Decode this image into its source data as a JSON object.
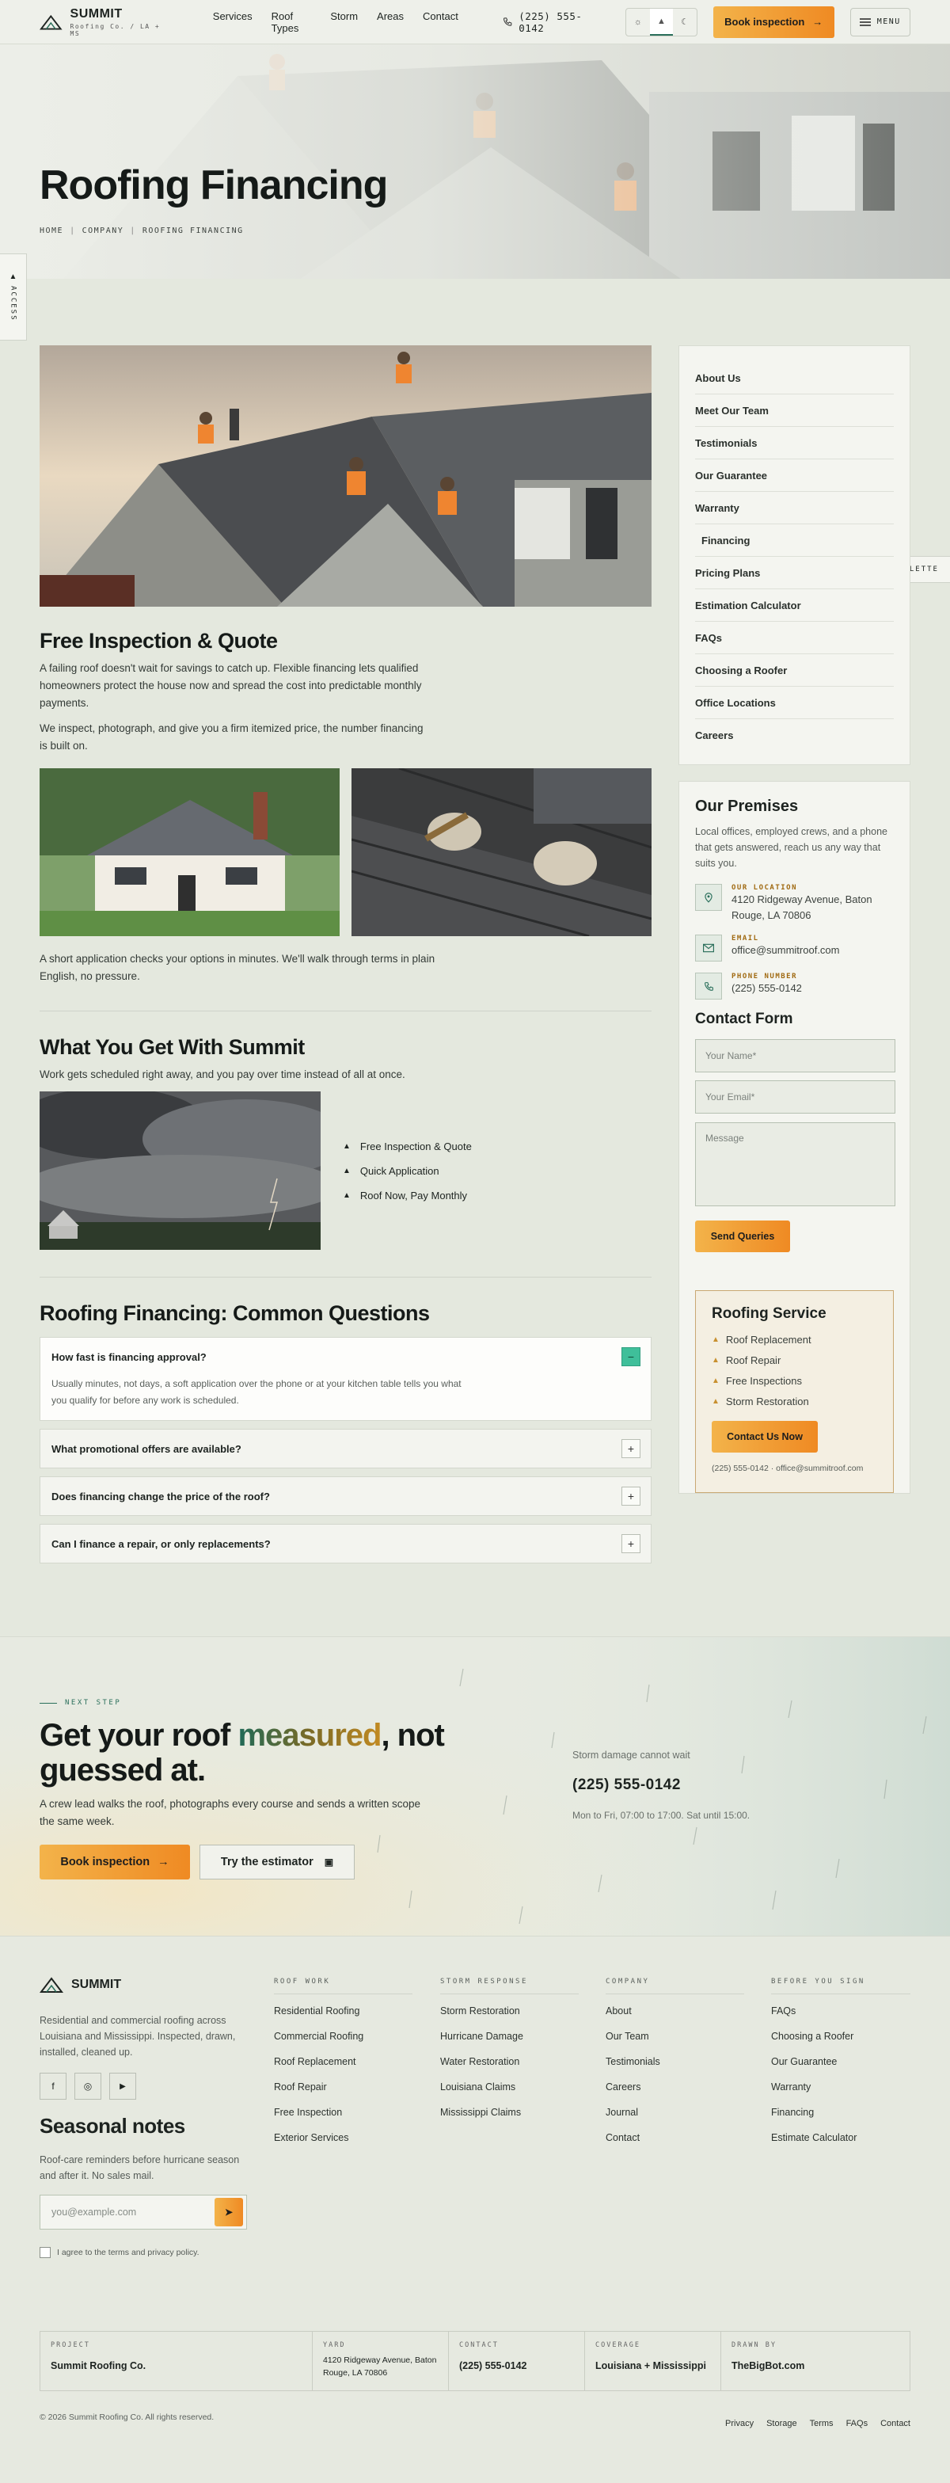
{
  "header": {
    "logo_name": "SUMMIT",
    "logo_sub": "Roofing Co. / LA + MS",
    "nav": [
      "Services",
      "Roof Types",
      "Storm",
      "Areas",
      "Contact"
    ],
    "phone": "(225) 555-0142",
    "book_label": "Book inspection",
    "menu_label": "MENU"
  },
  "side_tabs": {
    "access": "ACCESS",
    "palette": "PALETTE"
  },
  "hero": {
    "title": "Roofing Financing",
    "crumbs": [
      "HOME",
      "COMPANY",
      "ROOFING FINANCING"
    ]
  },
  "main": {
    "section1_title": "Free Inspection & Quote",
    "section1_p1": "A failing roof doesn't wait for savings to catch up. Flexible financing lets qualified homeowners protect the house now and spread the cost into predictable monthly payments.",
    "section1_p2": "We inspect, photograph, and give you a firm itemized price, the number financing is built on.",
    "section1_p3": "A short application checks your options in minutes. We'll walk through terms in plain English, no pressure.",
    "section2_title": "What You Get With Summit",
    "section2_lead": "Work gets scheduled right away, and you pay over time instead of all at once.",
    "benefits": [
      "Free Inspection & Quote",
      "Quick Application",
      "Roof Now, Pay Monthly"
    ],
    "faq_title": "Roofing Financing: Common Questions",
    "faqs": [
      {
        "q": "How fast is financing approval?",
        "a": "Usually minutes, not days, a soft application over the phone or at your kitchen table tells you what you qualify for before any work is scheduled."
      },
      {
        "q": "What promotional offers are available?",
        "a": ""
      },
      {
        "q": "Does financing change the price of the roof?",
        "a": ""
      },
      {
        "q": "Can I finance a repair, or only replacements?",
        "a": ""
      }
    ]
  },
  "sidebar": {
    "menu": [
      "About Us",
      "Meet Our Team",
      "Testimonials",
      "Our Guarantee",
      "Warranty",
      "Financing",
      "Pricing Plans",
      "Estimation Calculator",
      "FAQs",
      "Choosing a Roofer",
      "Office Locations",
      "Careers"
    ],
    "active_index": 5,
    "premises_title": "Our Premises",
    "premises_text": "Local offices, employed crews, and a phone that gets answered, reach us any way that suits you.",
    "location_label": "OUR LOCATION",
    "location_value": "4120 Ridgeway Avenue, Baton Rouge, LA 70806",
    "email_label": "EMAIL",
    "email_value": "office@summitroof.com",
    "phone_label": "PHONE NUMBER",
    "phone_value": "(225) 555-0142",
    "form_title": "Contact Form",
    "name_placeholder": "Your Name*",
    "email_placeholder": "Your Email*",
    "message_placeholder": "Message",
    "send_label": "Send Queries",
    "service_title": "Roofing Service",
    "services": [
      "Roof Replacement",
      "Roof Repair",
      "Free Inspections",
      "Storm Restoration"
    ],
    "service_cta": "Contact Us Now",
    "service_foot": "(225) 555-0142 · office@summitroof.com"
  },
  "cta": {
    "eyebrow": "NEXT STEP",
    "title_pre": "Get your roof ",
    "title_accent": "measured",
    "title_post": ", not guessed at.",
    "text": "A crew lead walks the roof, photographs every course and sends a written scope the same week.",
    "book_label": "Book inspection",
    "estimator_label": "Try the estimator",
    "storm_note": "Storm damage cannot wait",
    "phone": "(225) 555-0142",
    "hours": "Mon to Fri, 07:00 to 17:00. Sat until 15:00."
  },
  "footer": {
    "brand": "SUMMIT",
    "about": "Residential and commercial roofing across Louisiana and Mississippi. Inspected, drawn, installed, cleaned up.",
    "seasonal_title": "Seasonal notes",
    "seasonal_text": "Roof-care reminders before hurricane season and after it. No sales mail.",
    "email_placeholder": "you@example.com",
    "consent": "I agree to the terms and privacy policy.",
    "columns": [
      {
        "title": "ROOF WORK",
        "links": [
          "Residential Roofing",
          "Commercial Roofing",
          "Roof Replacement",
          "Roof Repair",
          "Free Inspection",
          "Exterior Services"
        ]
      },
      {
        "title": "STORM RESPONSE",
        "links": [
          "Storm Restoration",
          "Hurricane Damage",
          "Water Restoration",
          "Louisiana Claims",
          "Mississippi Claims"
        ]
      },
      {
        "title": "COMPANY",
        "links": [
          "About",
          "Our Team",
          "Testimonials",
          "Careers",
          "Journal",
          "Contact"
        ]
      },
      {
        "title": "BEFORE YOU SIGN",
        "links": [
          "FAQs",
          "Choosing a Roofer",
          "Our Guarantee",
          "Warranty",
          "Financing",
          "Estimate Calculator"
        ]
      }
    ],
    "stats": [
      {
        "k": "PROJECT",
        "v": "Summit Roofing Co."
      },
      {
        "k": "YARD",
        "v": "4120 Ridgeway Avenue, Baton Rouge, LA 70806"
      },
      {
        "k": "CONTACT",
        "v": "(225) 555-0142"
      },
      {
        "k": "COVERAGE",
        "v": "Louisiana + Mississippi"
      },
      {
        "k": "DRAWN BY",
        "v": "TheBigBot.com"
      }
    ],
    "copyright": "© 2026 Summit Roofing Co. All rights reserved.",
    "bottom_links": [
      "Privacy",
      "Storage",
      "Terms",
      "FAQs",
      "Contact"
    ]
  },
  "colors": {
    "accent_orange": "#ef8a23",
    "accent_green": "#2a6f5b",
    "accent_gold": "#a06a12"
  }
}
